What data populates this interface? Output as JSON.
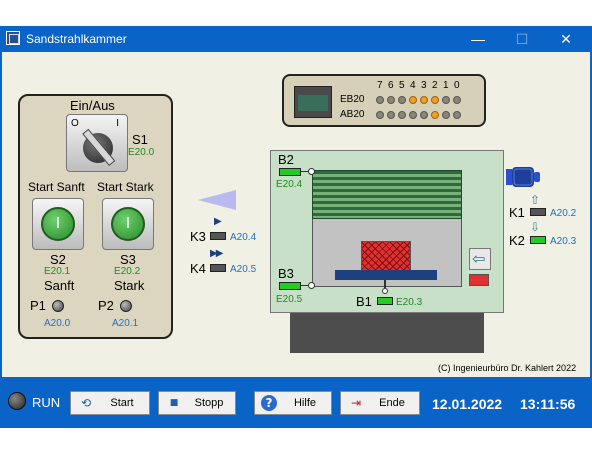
{
  "window": {
    "title": "Sandstrahlkammer",
    "minimize": "—",
    "maximize": "☐",
    "close": "✕"
  },
  "left_panel": {
    "switch_title": "Ein/Aus",
    "s1": {
      "label": "S1",
      "addr": "E20.0",
      "pos0": "O",
      "pos1": "I"
    },
    "start_sanft": "Start Sanft",
    "start_stark": "Start Stark",
    "s2": {
      "label": "S2",
      "addr": "E20.1",
      "symbol": "I"
    },
    "s3": {
      "label": "S3",
      "addr": "E20.2",
      "symbol": "I"
    },
    "sanft": "Sanft",
    "stark": "Stark",
    "p1": {
      "label": "P1",
      "addr": "A20.0"
    },
    "p2": {
      "label": "P2",
      "addr": "A20.1"
    }
  },
  "plc": {
    "bits": [
      "7",
      "6",
      "5",
      "4",
      "3",
      "2",
      "1",
      "0"
    ],
    "eb_label": "EB20",
    "ab_label": "AB20",
    "eb_states": [
      0,
      0,
      0,
      1,
      1,
      1,
      0,
      0
    ],
    "ab_states": [
      0,
      0,
      0,
      0,
      0,
      1,
      0,
      0
    ]
  },
  "chamber": {
    "b2": {
      "label": "B2",
      "addr": "E20.4"
    },
    "b3": {
      "label": "B3",
      "addr": "E20.5"
    },
    "b1": {
      "label": "B1",
      "addr": "E20.3"
    },
    "k3": {
      "label": "K3",
      "addr": "A20.4",
      "arrow": "▶"
    },
    "k4": {
      "label": "K4",
      "addr": "A20.5",
      "arrow": "▶▶"
    },
    "k1": {
      "label": "K1",
      "addr": "A20.2",
      "arrow": "⇧"
    },
    "k2": {
      "label": "K2",
      "addr": "A20.3",
      "arrow": "⇩"
    }
  },
  "copyright": "(C) Ingenieurbüro Dr. Kahlert 2022",
  "bottom": {
    "run": "RUN",
    "buttons": [
      {
        "label": "Start",
        "icon": "⟲"
      },
      {
        "label": "Stopp",
        "icon": "■"
      },
      {
        "label": "Hilfe",
        "icon": "?"
      },
      {
        "label": "Ende",
        "icon": "⇥"
      }
    ],
    "date": "12.01.2022",
    "time": "13:11:56"
  },
  "colors": {
    "titlebar": "#0a64c8",
    "client": "#f0f0e4",
    "sensor_on": "#22cc22",
    "led_on": "#f0a020",
    "address_green": "#1f8a1f",
    "address_blue": "#1f6fc0"
  }
}
